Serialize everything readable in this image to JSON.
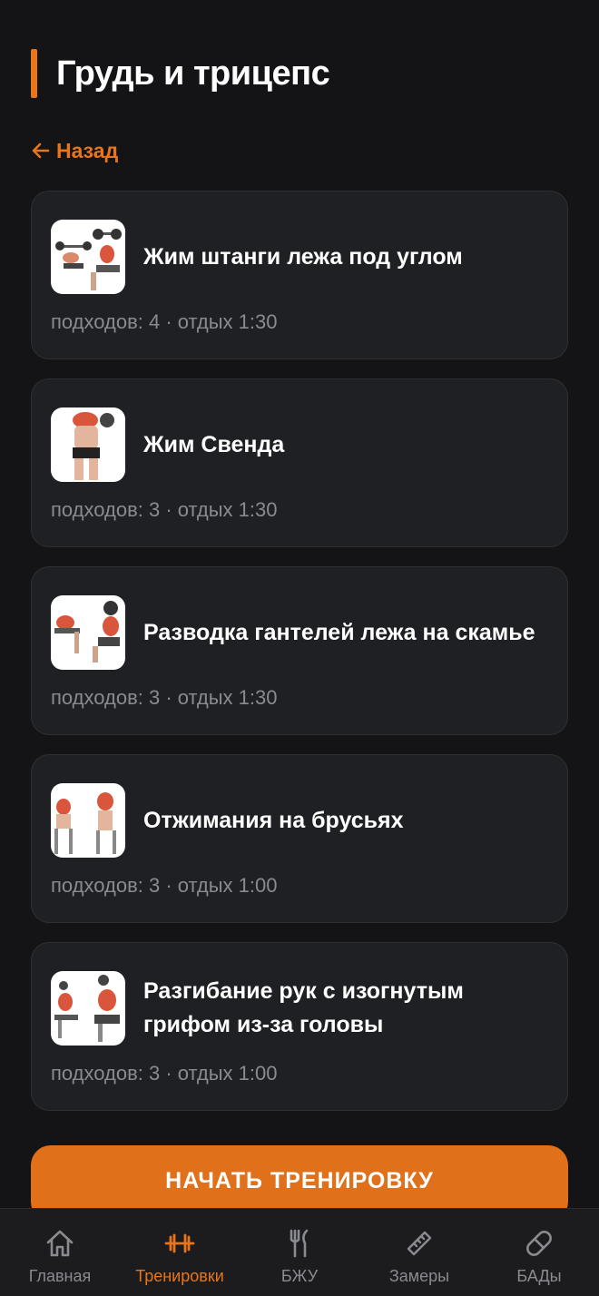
{
  "header": {
    "title": "Грудь и трицепс"
  },
  "back": {
    "label": "Назад"
  },
  "exercises": [
    {
      "name": "Жим штанги лежа под углом",
      "meta": "подходов: 4 · отдых 1:30"
    },
    {
      "name": "Жим Свенда",
      "meta": "подходов: 3 · отдых 1:30"
    },
    {
      "name": "Разводка гантелей лежа на скамье",
      "meta": "подходов: 3 · отдых 1:30"
    },
    {
      "name": "Отжимания на брусьях",
      "meta": "подходов: 3 · отдых 1:00"
    },
    {
      "name": "Разгибание рук с изогнутым грифом из-за головы",
      "meta": "подходов: 3 · отдых 1:00"
    }
  ],
  "start_button": {
    "label": "НАЧАТЬ ТРЕНИРОВКУ"
  },
  "tabbar": {
    "items": [
      {
        "label": "Главная",
        "icon": "home-icon"
      },
      {
        "label": "Тренировки",
        "icon": "dumbbell-icon",
        "active": true
      },
      {
        "label": "БЖУ",
        "icon": "fork-knife-icon"
      },
      {
        "label": "Замеры",
        "icon": "ruler-icon"
      },
      {
        "label": "БАДы",
        "icon": "pill-icon"
      }
    ]
  },
  "colors": {
    "accent": "#e8751a",
    "background": "#141416",
    "card": "#1f2023",
    "muted": "#8a8b90"
  }
}
